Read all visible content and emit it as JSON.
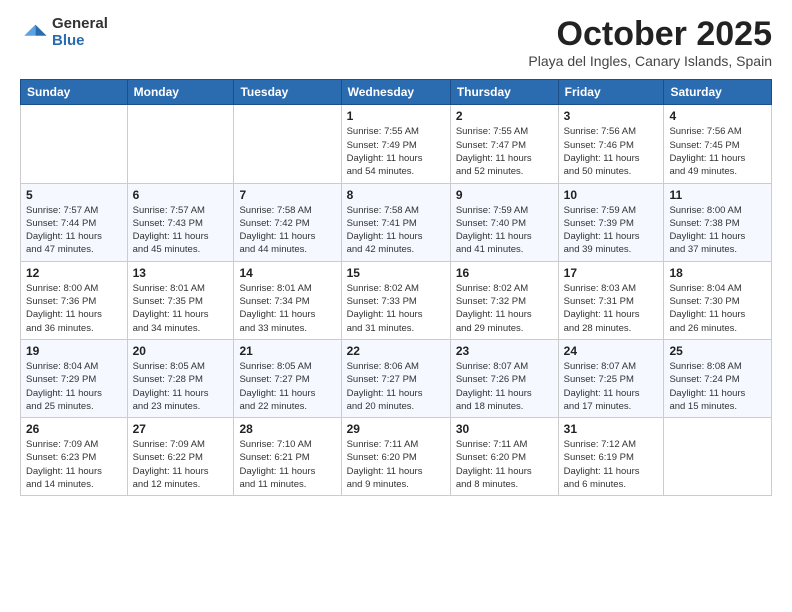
{
  "header": {
    "logo_general": "General",
    "logo_blue": "Blue",
    "month_title": "October 2025",
    "location": "Playa del Ingles, Canary Islands, Spain"
  },
  "weekdays": [
    "Sunday",
    "Monday",
    "Tuesday",
    "Wednesday",
    "Thursday",
    "Friday",
    "Saturday"
  ],
  "weeks": [
    [
      {
        "day": "",
        "info": ""
      },
      {
        "day": "",
        "info": ""
      },
      {
        "day": "",
        "info": ""
      },
      {
        "day": "1",
        "info": "Sunrise: 7:55 AM\nSunset: 7:49 PM\nDaylight: 11 hours\nand 54 minutes."
      },
      {
        "day": "2",
        "info": "Sunrise: 7:55 AM\nSunset: 7:47 PM\nDaylight: 11 hours\nand 52 minutes."
      },
      {
        "day": "3",
        "info": "Sunrise: 7:56 AM\nSunset: 7:46 PM\nDaylight: 11 hours\nand 50 minutes."
      },
      {
        "day": "4",
        "info": "Sunrise: 7:56 AM\nSunset: 7:45 PM\nDaylight: 11 hours\nand 49 minutes."
      }
    ],
    [
      {
        "day": "5",
        "info": "Sunrise: 7:57 AM\nSunset: 7:44 PM\nDaylight: 11 hours\nand 47 minutes."
      },
      {
        "day": "6",
        "info": "Sunrise: 7:57 AM\nSunset: 7:43 PM\nDaylight: 11 hours\nand 45 minutes."
      },
      {
        "day": "7",
        "info": "Sunrise: 7:58 AM\nSunset: 7:42 PM\nDaylight: 11 hours\nand 44 minutes."
      },
      {
        "day": "8",
        "info": "Sunrise: 7:58 AM\nSunset: 7:41 PM\nDaylight: 11 hours\nand 42 minutes."
      },
      {
        "day": "9",
        "info": "Sunrise: 7:59 AM\nSunset: 7:40 PM\nDaylight: 11 hours\nand 41 minutes."
      },
      {
        "day": "10",
        "info": "Sunrise: 7:59 AM\nSunset: 7:39 PM\nDaylight: 11 hours\nand 39 minutes."
      },
      {
        "day": "11",
        "info": "Sunrise: 8:00 AM\nSunset: 7:38 PM\nDaylight: 11 hours\nand 37 minutes."
      }
    ],
    [
      {
        "day": "12",
        "info": "Sunrise: 8:00 AM\nSunset: 7:36 PM\nDaylight: 11 hours\nand 36 minutes."
      },
      {
        "day": "13",
        "info": "Sunrise: 8:01 AM\nSunset: 7:35 PM\nDaylight: 11 hours\nand 34 minutes."
      },
      {
        "day": "14",
        "info": "Sunrise: 8:01 AM\nSunset: 7:34 PM\nDaylight: 11 hours\nand 33 minutes."
      },
      {
        "day": "15",
        "info": "Sunrise: 8:02 AM\nSunset: 7:33 PM\nDaylight: 11 hours\nand 31 minutes."
      },
      {
        "day": "16",
        "info": "Sunrise: 8:02 AM\nSunset: 7:32 PM\nDaylight: 11 hours\nand 29 minutes."
      },
      {
        "day": "17",
        "info": "Sunrise: 8:03 AM\nSunset: 7:31 PM\nDaylight: 11 hours\nand 28 minutes."
      },
      {
        "day": "18",
        "info": "Sunrise: 8:04 AM\nSunset: 7:30 PM\nDaylight: 11 hours\nand 26 minutes."
      }
    ],
    [
      {
        "day": "19",
        "info": "Sunrise: 8:04 AM\nSunset: 7:29 PM\nDaylight: 11 hours\nand 25 minutes."
      },
      {
        "day": "20",
        "info": "Sunrise: 8:05 AM\nSunset: 7:28 PM\nDaylight: 11 hours\nand 23 minutes."
      },
      {
        "day": "21",
        "info": "Sunrise: 8:05 AM\nSunset: 7:27 PM\nDaylight: 11 hours\nand 22 minutes."
      },
      {
        "day": "22",
        "info": "Sunrise: 8:06 AM\nSunset: 7:27 PM\nDaylight: 11 hours\nand 20 minutes."
      },
      {
        "day": "23",
        "info": "Sunrise: 8:07 AM\nSunset: 7:26 PM\nDaylight: 11 hours\nand 18 minutes."
      },
      {
        "day": "24",
        "info": "Sunrise: 8:07 AM\nSunset: 7:25 PM\nDaylight: 11 hours\nand 17 minutes."
      },
      {
        "day": "25",
        "info": "Sunrise: 8:08 AM\nSunset: 7:24 PM\nDaylight: 11 hours\nand 15 minutes."
      }
    ],
    [
      {
        "day": "26",
        "info": "Sunrise: 7:09 AM\nSunset: 6:23 PM\nDaylight: 11 hours\nand 14 minutes."
      },
      {
        "day": "27",
        "info": "Sunrise: 7:09 AM\nSunset: 6:22 PM\nDaylight: 11 hours\nand 12 minutes."
      },
      {
        "day": "28",
        "info": "Sunrise: 7:10 AM\nSunset: 6:21 PM\nDaylight: 11 hours\nand 11 minutes."
      },
      {
        "day": "29",
        "info": "Sunrise: 7:11 AM\nSunset: 6:20 PM\nDaylight: 11 hours\nand 9 minutes."
      },
      {
        "day": "30",
        "info": "Sunrise: 7:11 AM\nSunset: 6:20 PM\nDaylight: 11 hours\nand 8 minutes."
      },
      {
        "day": "31",
        "info": "Sunrise: 7:12 AM\nSunset: 6:19 PM\nDaylight: 11 hours\nand 6 minutes."
      },
      {
        "day": "",
        "info": ""
      }
    ]
  ]
}
